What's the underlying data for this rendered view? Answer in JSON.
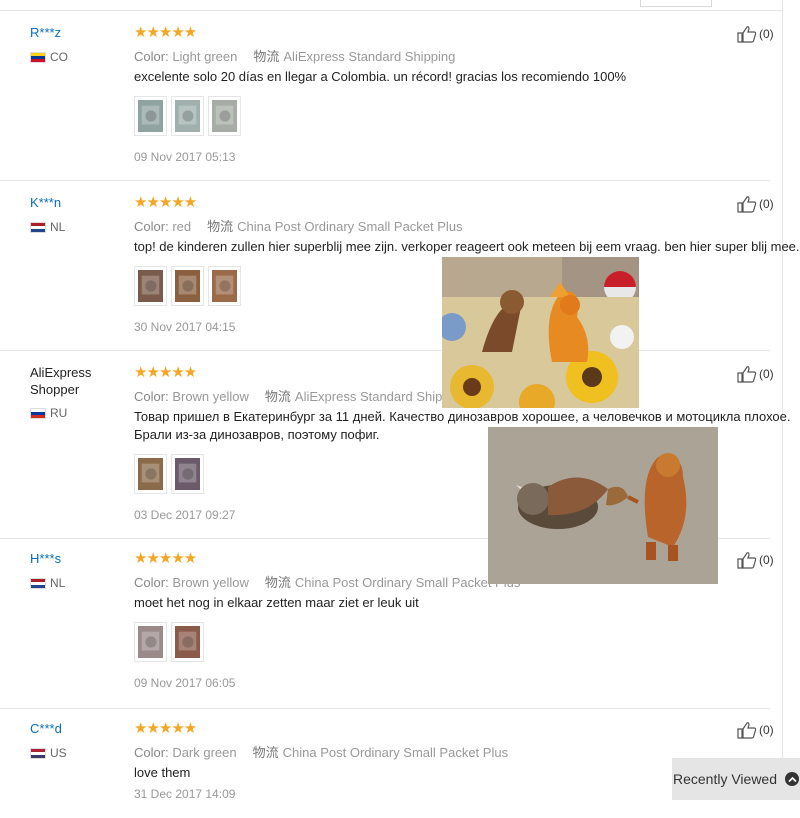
{
  "reviews": [
    {
      "user": "R***z",
      "country": "CO",
      "flag": [
        "#fcd116",
        "#003893",
        "#ce1126"
      ],
      "stars": "★★★★★",
      "color_label": "Color:",
      "color_value": "Light green",
      "ship_icon": "物流",
      "shipping": "AliExpress Standard Shipping",
      "text": [
        "excelente solo 20 días en llegar a Colombia. un récord! gracias los recomiendo 100%"
      ],
      "thumbs": [
        "#8fa3a0",
        "#9fb0ad",
        "#a7aca6"
      ],
      "date": "09 Nov 2017 05:13",
      "helpful": "(0)"
    },
    {
      "user": "K***n",
      "country": "NL",
      "flag": [
        "#ae1c28",
        "#ffffff",
        "#21468b"
      ],
      "stars": "★★★★★",
      "color_label": "Color:",
      "color_value": "red",
      "ship_icon": "物流",
      "shipping": "China Post Ordinary Small Packet Plus",
      "text": [
        "top! de kinderen zullen hier superblij mee zijn. verkoper reageert ook meteen bij eem vraag. ben hier super blij mee."
      ],
      "thumbs": [
        "#7a5a4a",
        "#8a6040",
        "#9a6a4a"
      ],
      "date": "30 Nov 2017 04:15",
      "helpful": "(0)"
    },
    {
      "user": "AliExpress Shopper",
      "country": "RU",
      "flag": [
        "#ffffff",
        "#0039a6",
        "#d52b1e"
      ],
      "stars": "★★★★★",
      "color_label": "Color:",
      "color_value": "Brown yellow",
      "ship_icon": "物流",
      "shipping": "AliExpress Standard Shipping",
      "text": [
        "Товар пришел в Екатеринбург за 11 дней. Качество динозавров хорошее, а человечков и мотоцикла плохое.",
        "Брали из-за динозавров, поэтому пофиг."
      ],
      "thumbs": [
        "#8b6a4a",
        "#6a5a6a"
      ],
      "date": "03 Dec 2017 09:27",
      "helpful": "(0)"
    },
    {
      "user": "H***s",
      "country": "NL",
      "flag": [
        "#ae1c28",
        "#ffffff",
        "#21468b"
      ],
      "stars": "★★★★★",
      "color_label": "Color:",
      "color_value": "Brown yellow",
      "ship_icon": "物流",
      "shipping": "China Post Ordinary Small Packet Plus",
      "text": [
        "moet het nog in elkaar zetten maar ziet er leuk uit"
      ],
      "thumbs": [
        "#9a8a8a",
        "#8a5a4a"
      ],
      "date": "09 Nov 2017 06:05",
      "helpful": "(0)"
    },
    {
      "user": "C***d",
      "country": "US",
      "flag": [
        "#b22234",
        "#ffffff",
        "#3c3b6e"
      ],
      "stars": "★★★★★",
      "color_label": "Color:",
      "color_value": "Dark green",
      "ship_icon": "物流",
      "shipping": "China Post Ordinary Small Packet Plus",
      "text": [
        "love them"
      ],
      "thumbs": [],
      "date": "31 Dec 2017 14:09",
      "helpful": "(0)"
    }
  ],
  "recently_viewed": {
    "label": "Recently Viewed",
    "icon": "chevron-up-icon"
  },
  "popups": [
    {
      "name": "review-photo-popup-dinosaurs-table",
      "palette": [
        "#e8c24a",
        "#d8862a",
        "#7a4a2a"
      ]
    },
    {
      "name": "review-photo-popup-dinosaurs-carpet",
      "palette": [
        "#a89f94",
        "#6a5a4a",
        "#c07030"
      ]
    }
  ],
  "colors": {
    "user_link": "#0a6ebd",
    "star": "#f5a623",
    "divider": "#e6e6e6"
  }
}
